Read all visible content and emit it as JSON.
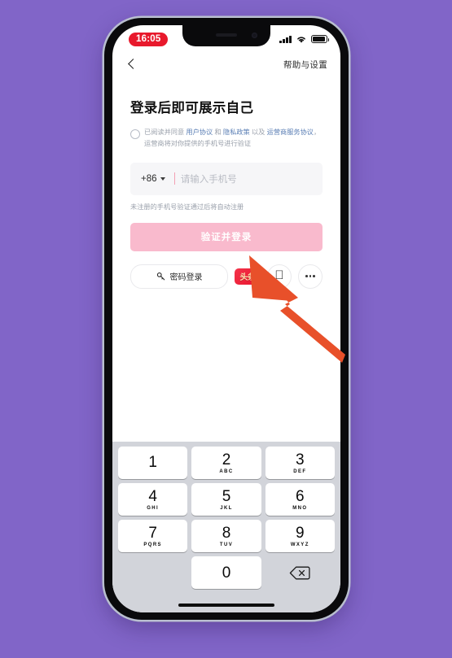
{
  "background_color": "#8165c8",
  "status_bar": {
    "time": "16:05",
    "time_badge_color": "#e8192c",
    "signal_icon": "cellular-bars-icon",
    "wifi_icon": "wifi-icon",
    "battery_icon": "battery-icon"
  },
  "nav": {
    "back_icon": "back-chevron-icon",
    "help_settings": "帮助与设置"
  },
  "main": {
    "title": "登录后即可展示自己",
    "agreement": {
      "prefix": "已阅读并同意 ",
      "link1": "用户协议",
      "mid1": " 和 ",
      "link2": "隐私政策",
      "mid2": " 以及 ",
      "link3": "运营商服务协议",
      "suffix": "，运营商将对你提供的手机号进行验证",
      "link_color": "#5b7fb5",
      "checked": false
    },
    "phone_input": {
      "country_code": "+86",
      "placeholder": "请输入手机号",
      "value": "",
      "hint": "未注册的手机号验证通过后将自动注册"
    },
    "primary_button": {
      "label": "验证并登录",
      "color": "#f9bacd"
    },
    "alt_login": {
      "password_label": "密码登录",
      "password_icon": "key-icon",
      "toutiao_label": "头条",
      "toutiao_color": "#e8122c",
      "apple_icon": "apple-logo-icon",
      "more_icon": "more-dots-icon"
    }
  },
  "keyboard": {
    "rows": [
      [
        {
          "num": "1",
          "sub": ""
        },
        {
          "num": "2",
          "sub": "ABC"
        },
        {
          "num": "3",
          "sub": "DEF"
        }
      ],
      [
        {
          "num": "4",
          "sub": "GHI"
        },
        {
          "num": "5",
          "sub": "JKL"
        },
        {
          "num": "6",
          "sub": "MNO"
        }
      ],
      [
        {
          "num": "7",
          "sub": "PQRS"
        },
        {
          "num": "8",
          "sub": "TUV"
        },
        {
          "num": "9",
          "sub": "WXYZ"
        }
      ]
    ],
    "zero": {
      "num": "0",
      "sub": ""
    },
    "backspace_icon": "backspace-icon"
  },
  "annotation": {
    "arrow_icon": "pointer-arrow-icon",
    "arrow_color": "#e8502a"
  }
}
